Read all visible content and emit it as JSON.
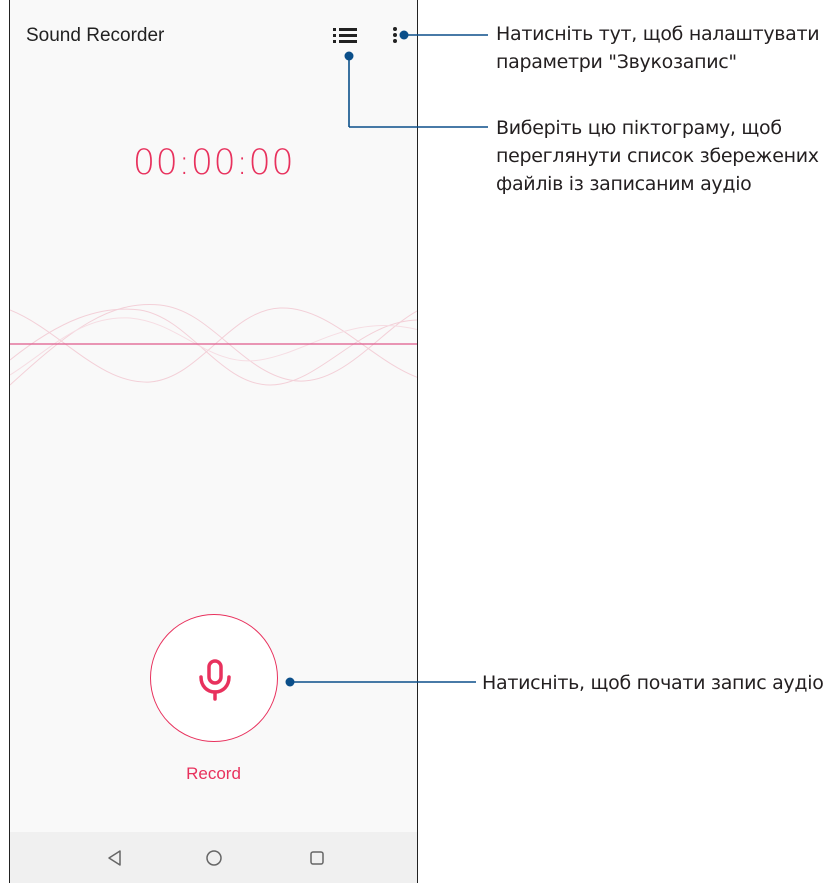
{
  "header": {
    "app_title": "Sound Recorder",
    "list_icon": "list-icon",
    "more_icon": "more-vert-icon"
  },
  "timer": {
    "value": "00:00:00"
  },
  "record": {
    "label": "Record",
    "icon": "microphone-icon"
  },
  "navbar": {
    "back_icon": "back-triangle-icon",
    "home_icon": "home-circle-icon",
    "recents_icon": "recents-square-icon"
  },
  "callouts": {
    "menu": "Натисніть тут, щоб налаштувати\nпараметри \"Звукозапис\"",
    "list": "Виберіть цю піктограму, щоб\nпереглянути список збережених\nфайлів із записаним аудіо",
    "record": "Натисніть, щоб почати запис аудіо"
  },
  "colors": {
    "accent": "#e8315d",
    "callout_line": "#0b4f8a",
    "screen_bg": "#f9f9f9",
    "navbar_bg": "#f0f0f0"
  }
}
